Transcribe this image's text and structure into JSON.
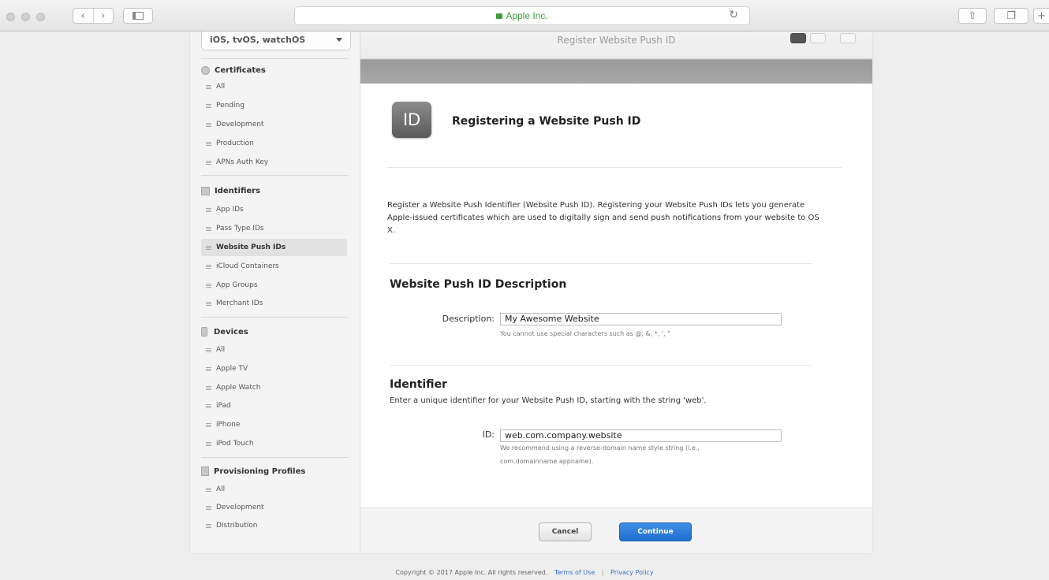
{
  "browser": {
    "address": "Apple Inc.",
    "icons": {
      "back": "chevron-left-icon",
      "forward": "chevron-right-icon",
      "sidebar": "sidebar-icon",
      "reload": "reload-icon",
      "share": "share-icon",
      "tabs": "tabs-icon",
      "new_tab": "plus-icon"
    }
  },
  "sidebar": {
    "platform": "iOS, tvOS, watchOS",
    "sections": {
      "certificates": {
        "title": "Certificates",
        "items": [
          "All",
          "Pending",
          "Development",
          "Production",
          "APNs Auth Key"
        ]
      },
      "identifiers": {
        "title": "Identifiers",
        "items": [
          "App IDs",
          "Pass Type IDs",
          "Website Push IDs",
          "iCloud Containers",
          "App Groups",
          "Merchant IDs"
        ]
      },
      "devices": {
        "title": "Devices",
        "items": [
          "All",
          "Apple TV",
          "Apple Watch",
          "iPad",
          "iPhone",
          "iPod Touch"
        ]
      },
      "profiles": {
        "title": "Provisioning Profiles",
        "items": [
          "All",
          "Development",
          "Distribution"
        ]
      }
    },
    "active_item": "Website Push IDs"
  },
  "header": {
    "title": "Register Website Push ID"
  },
  "main": {
    "badge": "ID",
    "title": "Registering a Website Push ID",
    "intro": "Register a Website Push Identifier (Website Push ID). Registering your Website Push IDs lets you generate Apple-issued certificates which are used to digitally sign and send push notifications from your website to OS X.",
    "description_section": {
      "heading": "Website Push ID Description",
      "label": "Description:",
      "value": "My Awesome Website",
      "help": "You cannot use special characters such as @, &, *, ', \""
    },
    "identifier_section": {
      "heading": "Identifier",
      "subtext": "Enter a unique identifier for your Website Push ID, starting with the string 'web'.",
      "label": "ID:",
      "value": "web.com.company.website",
      "help_line1": "We recommend using a reverse-domain name style string (i.e.,",
      "help_line2": "com.domainname.appname)."
    },
    "buttons": {
      "cancel": "Cancel",
      "continue": "Continue"
    }
  },
  "footer": {
    "copyright": "Copyright © 2017 Apple Inc. All rights reserved.",
    "terms": "Terms of Use",
    "separator": "|",
    "privacy": "Privacy Policy"
  },
  "colors": {
    "accent": "#1f6dcd",
    "link": "#3471c2",
    "secure": "#3a9f3a"
  }
}
